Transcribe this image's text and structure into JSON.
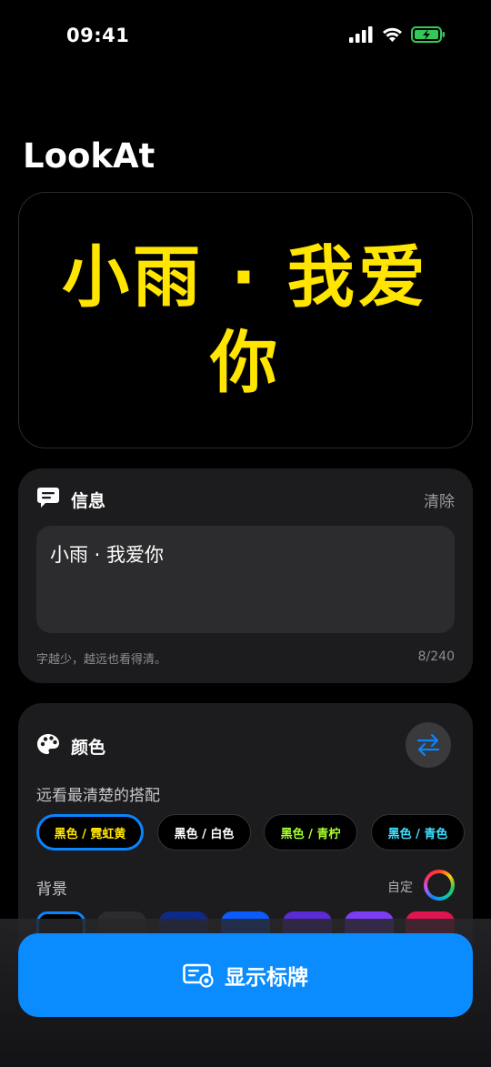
{
  "status": {
    "time": "09:41"
  },
  "app": {
    "title": "LookAt"
  },
  "preview": {
    "text": "小雨 · 我爱你",
    "color": "#FFE500",
    "background": "#000000"
  },
  "message": {
    "title": "信息",
    "clear_label": "清除",
    "value": "小雨 · 我爱你",
    "hint": "字越少，越远也看得清。",
    "counter": "8/240"
  },
  "color": {
    "title": "颜色",
    "subtitle": "远看最清楚的搭配",
    "presets": [
      {
        "label": "黑色 / 霓虹黄",
        "text_color": "#FFE500",
        "selected": true
      },
      {
        "label": "黑色 / 白色",
        "text_color": "#FFFFFF",
        "selected": false
      },
      {
        "label": "黑色 / 青柠",
        "text_color": "#A6FF2E",
        "selected": false
      },
      {
        "label": "黑色 / 青色",
        "text_color": "#3FE0FF",
        "selected": false
      }
    ],
    "background_label": "背景",
    "custom_label": "自定",
    "swatches": [
      "#000000",
      "#2c2c2e",
      "#0d2a8a",
      "#0a5cff",
      "#5b2bd6",
      "#7d3cf5",
      "#e0144f"
    ]
  },
  "cta": {
    "label": "显示标牌",
    "color": "#0A8CFF"
  }
}
